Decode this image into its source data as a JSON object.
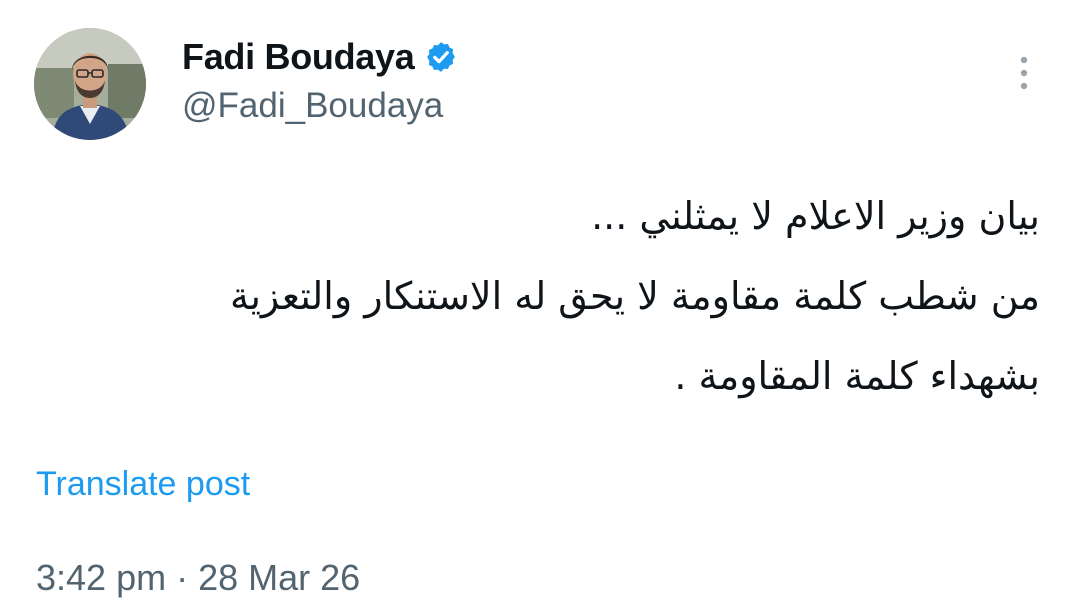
{
  "author": {
    "display_name": "Fadi Boudaya",
    "handle": "@Fadi_Boudaya",
    "verified": true,
    "avatar_icon": "profile-photo"
  },
  "menu": {
    "icon": "more-vertical-icon"
  },
  "tweet": {
    "lines": [
      "بيان وزير الاعلام لا يمثلني ...",
      "من شطب كلمة مقاومة لا يحق له الاستنكار والتعزية",
      "بشهداء كلمة المقاومة ."
    ]
  },
  "translate_label": "Translate post",
  "timestamp": "3:42 pm · 28 Mar 26",
  "colors": {
    "text": "#0f1419",
    "secondary": "#536471",
    "accent": "#1d9bf0"
  }
}
